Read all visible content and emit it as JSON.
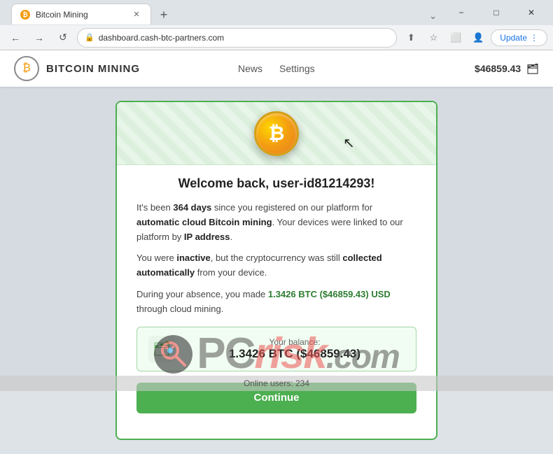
{
  "browser": {
    "tab_title": "Bitcoin Mining",
    "tab_favicon": "₿",
    "url": "dashboard.cash-btc-partners.com",
    "new_tab_label": "+",
    "nav_back": "←",
    "nav_forward": "→",
    "nav_reload": "↺",
    "update_btn": "Update",
    "win_minimize": "−",
    "win_maximize": "□",
    "win_close": "✕"
  },
  "site": {
    "logo_icon": "₿",
    "logo_text": "BITCOIN MINING",
    "nav_news": "News",
    "nav_settings": "Settings",
    "balance_header": "$46859.43",
    "wallet_folder_icon": "🗂"
  },
  "card": {
    "bitcoin_symbol": "₿",
    "welcome_title": "Welcome back, user-id81214293!",
    "paragraph1": "It's been ",
    "days_count": "364 days",
    "paragraph1b": " since you registered on our platform for ",
    "auto_mining": "automatic cloud Bitcoin mining",
    "paragraph1c": ". Your devices were linked to our platform by ",
    "ip_link": "IP address",
    "paragraph1d": ".",
    "paragraph2a": "You were ",
    "inactive": "inactive",
    "paragraph2b": ", but the cryptocurrency was still ",
    "collected": "collected automatically",
    "paragraph2c": " from your device.",
    "paragraph3a": "During your absence, you made ",
    "btc_earned": "1.3426 BTC ($46859.43) USD",
    "paragraph3b": " through cloud mining.",
    "balance_label": "Your balance:",
    "balance_amount": "1.3426 BTC ($46859.43)",
    "continue_btn": "Continue"
  },
  "footer": {
    "online_users_label": "Online users:",
    "online_users_count": "234"
  },
  "watermark": {
    "pc": "PC",
    "risk": "risk",
    "com": ".com"
  }
}
